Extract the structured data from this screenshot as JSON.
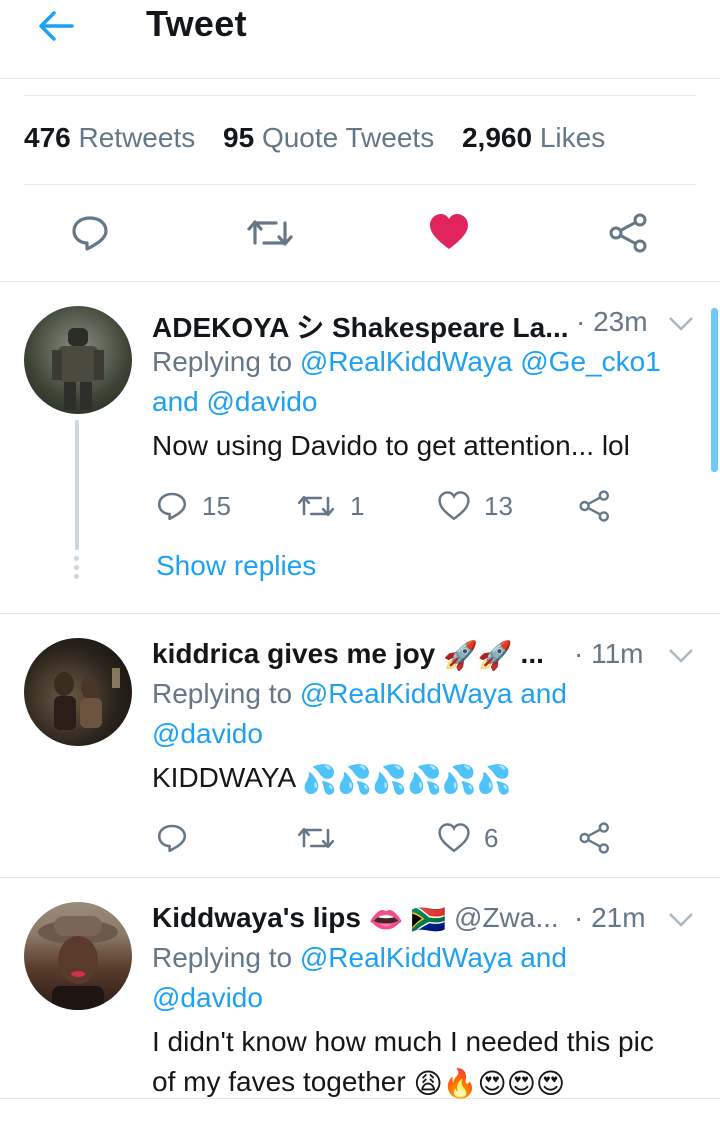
{
  "header": {
    "title": "Tweet"
  },
  "stats": {
    "retweets_count": "476",
    "retweets_label": "Retweets",
    "quotes_count": "95",
    "quotes_label": "Quote Tweets",
    "likes_count": "2,960",
    "likes_label": "Likes"
  },
  "colors": {
    "accent": "#1da1f2",
    "like": "#e0245e",
    "muted": "#657786",
    "border": "#e1e8ed"
  },
  "replies": [
    {
      "name": "ADEKOYA シ Shakespeare La...",
      "time": "· 23m",
      "replying_prefix": "Replying to",
      "mentions_line1": "@RealKiddWaya @Ge_cko1",
      "mentions_line2": "and @davido",
      "text": "Now using Davido to get attention... lol",
      "reply_count": "15",
      "retweet_count": "1",
      "like_count": "13",
      "show_replies": "Show replies"
    },
    {
      "name": "kiddrica gives me joy",
      "name_emoji": "🚀🚀",
      "name_ellipsis": "...",
      "time": "· 11m",
      "replying_prefix": "Replying to",
      "mentions_line1": "@RealKiddWaya and",
      "mentions_line2": "@davido",
      "text": "KIDDWAYA",
      "text_emoji": "💦💦💦💦💦💦",
      "like_count": "6"
    },
    {
      "name": "Kiddwaya's lips",
      "name_emoji": "👄 🇿🇦",
      "handle": "@Zwa...",
      "time": "· 21m",
      "replying_prefix": "Replying to",
      "mentions_line1": "@RealKiddWaya and",
      "mentions_line2": "@davido",
      "text_line1": "I didn't know how much I needed this pic",
      "text_line2": "of my faves together",
      "text_emoji": "😩🔥😍😍😍"
    }
  ]
}
